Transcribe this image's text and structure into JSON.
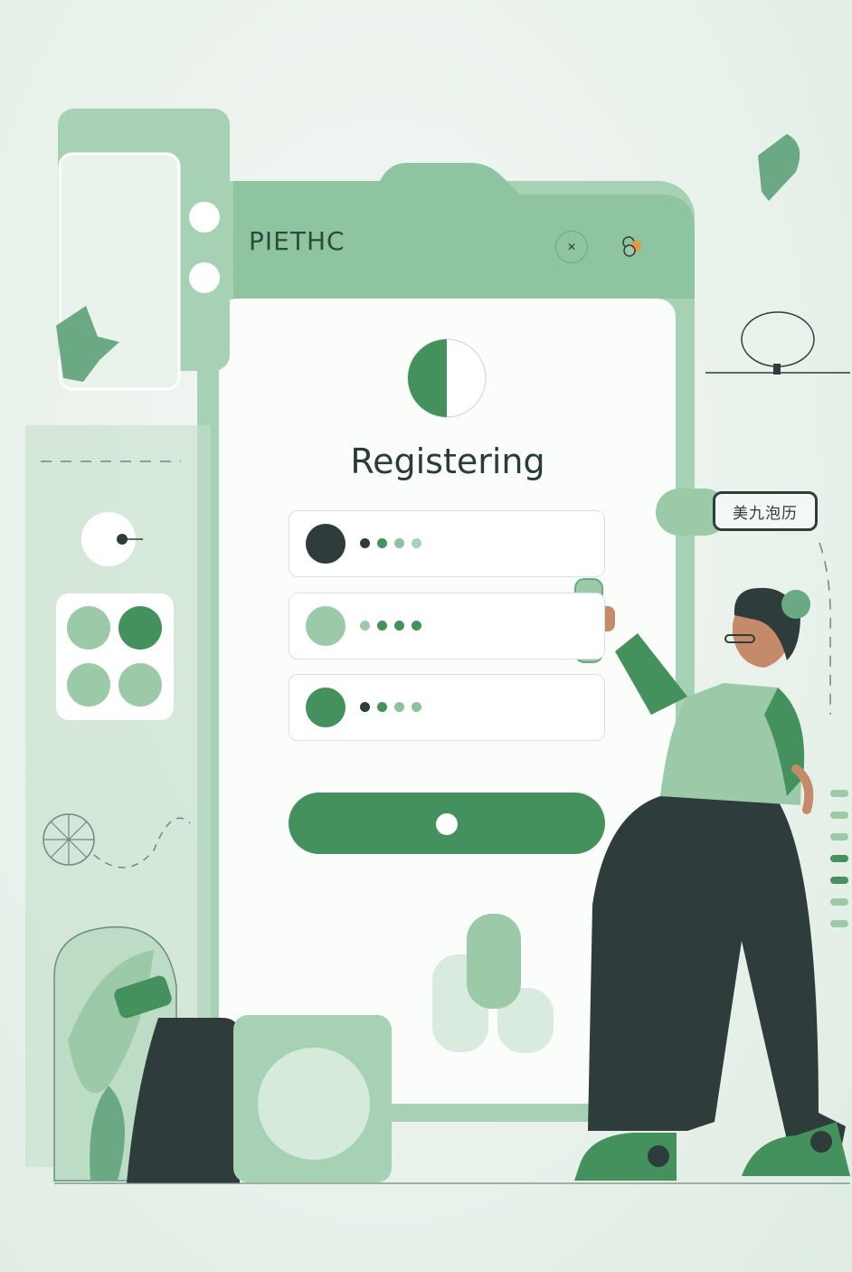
{
  "app": {
    "brand": "PIETHC"
  },
  "header": {
    "icons": [
      "close-icon",
      "flower-icon"
    ]
  },
  "main": {
    "status_title": "Registering",
    "progress": 0.5,
    "fields": [
      {
        "avatar_color": "#2e3c3b",
        "dot_colors": [
          "#2e3c3b",
          "#44915e",
          "#8cc39f",
          "#a8d3b6"
        ]
      },
      {
        "avatar_color": "#9ccaa9",
        "dot_colors": [
          "#9ccaa9",
          "#44915e",
          "#44915e",
          "#44915e"
        ]
      },
      {
        "avatar_color": "#44915e",
        "dot_colors": [
          "#2e3c3b",
          "#44915e",
          "#8cc39f",
          "#8cc39f"
        ]
      }
    ],
    "submit_icon": "dot-icon"
  },
  "side_tag": {
    "text": "美九泡历"
  },
  "colors": {
    "accent": "#44915e",
    "light_green": "#9ccaa9",
    "pale_green": "#c8e2d0",
    "dark": "#2e3c3b",
    "background": "#eef5f0"
  }
}
